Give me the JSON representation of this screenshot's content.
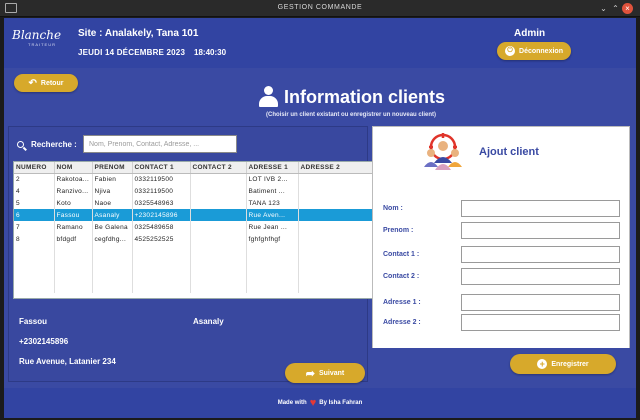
{
  "window": {
    "title": "GESTION COMMANDE"
  },
  "header": {
    "logo": {
      "script": "Blanche",
      "sub": "TRAITEUR"
    },
    "site": "Site : Analakely, Tana 101",
    "date": "JEUDI 14 DÉCEMBRE 2023",
    "time": "18:40:30",
    "user": "Admin",
    "logout_label": "Déconnexion"
  },
  "back_label": "Retour",
  "page": {
    "title": "Information clients",
    "subtitle": "(Choisir un client existant ou enregistrer un nouveau client)"
  },
  "search": {
    "label": "Recherche :",
    "placeholder": "Nom, Prenom, Contact, Adresse, ..."
  },
  "table": {
    "columns": [
      "NUMERO",
      "NOM",
      "PRENOM",
      "CONTACT 1",
      "CONTACT 2",
      "ADRESSE 1",
      "ADRESSE 2"
    ],
    "rows": [
      [
        "2",
        "Rakotoa...",
        "Fabien",
        "0332119500",
        "",
        "LOT IVB 2...",
        ""
      ],
      [
        "4",
        "Ranzivo...",
        "Njiva",
        "0332119500",
        "",
        "Batiment ...",
        ""
      ],
      [
        "5",
        "Koto",
        "Naoe",
        "0325548963",
        "",
        "TANA 123",
        ""
      ],
      [
        "6",
        "Fassou",
        "Asanaly",
        "+2302145896",
        "",
        "Rue Aven...",
        ""
      ],
      [
        "7",
        "Ramano",
        "Be Galena",
        "0325489658",
        "",
        "Rue Jean ...",
        ""
      ],
      [
        "8",
        "bfdgdf",
        "cegfdhg...",
        "4525252525",
        "",
        "fghfghfhgf",
        ""
      ],
      [
        "",
        "",
        "",
        "",
        "",
        "",
        ""
      ],
      [
        "",
        "",
        "",
        "",
        "",
        "",
        ""
      ],
      [
        "",
        "",
        "",
        "",
        "",
        "",
        ""
      ],
      [
        "",
        "",
        "",
        "",
        "",
        "",
        ""
      ]
    ],
    "selected_row_index": 3
  },
  "selected_client": {
    "name": "Fassou",
    "firstname": "Asanaly",
    "contact": "+2302145896",
    "address": "Rue Avenue, Latanier 234"
  },
  "next_label": "Suivant",
  "add_client": {
    "title": "Ajout client",
    "fields": [
      {
        "label": "Nom :",
        "value": ""
      },
      {
        "label": "Prenom :",
        "value": ""
      },
      {
        "label": "Contact 1 :",
        "value": ""
      },
      {
        "label": "Contact 2 :",
        "value": ""
      },
      {
        "label": "Adresse 1 :",
        "value": ""
      },
      {
        "label": "Adresse 2 :",
        "value": ""
      }
    ],
    "save_label": "Enregistrer"
  },
  "footer": {
    "made_with": "Made with",
    "by": "By Isha Fahran"
  },
  "colors": {
    "primary": "#3a4aa3",
    "gold": "#d7a92b",
    "selected_row": "#1a9bd7",
    "heart": "#e53935"
  },
  "icons": [
    "menu-icon",
    "logout-icon",
    "back-arrow-icon",
    "person-icon",
    "search-icon",
    "add-user-icon",
    "arrow-right-icon",
    "plus-icon",
    "heart-icon"
  ]
}
